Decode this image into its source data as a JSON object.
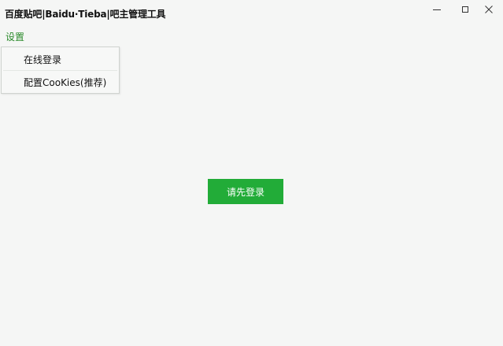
{
  "window": {
    "title": "百度贴吧|Baidu·Tieba|吧主管理工具",
    "minimize_icon": "minimize-icon",
    "maximize_icon": "maximize-icon",
    "close_icon": "close-icon"
  },
  "menu": {
    "settings_label": "设置",
    "dropdown_items": [
      {
        "label": "在线登录"
      },
      {
        "label": "配置CooKies(推荐)"
      }
    ]
  },
  "main": {
    "login_button_label": "请先登录"
  },
  "colors": {
    "accent": "#22ac38",
    "menu_text": "#2a8a2a",
    "background": "#f5f6f5"
  }
}
